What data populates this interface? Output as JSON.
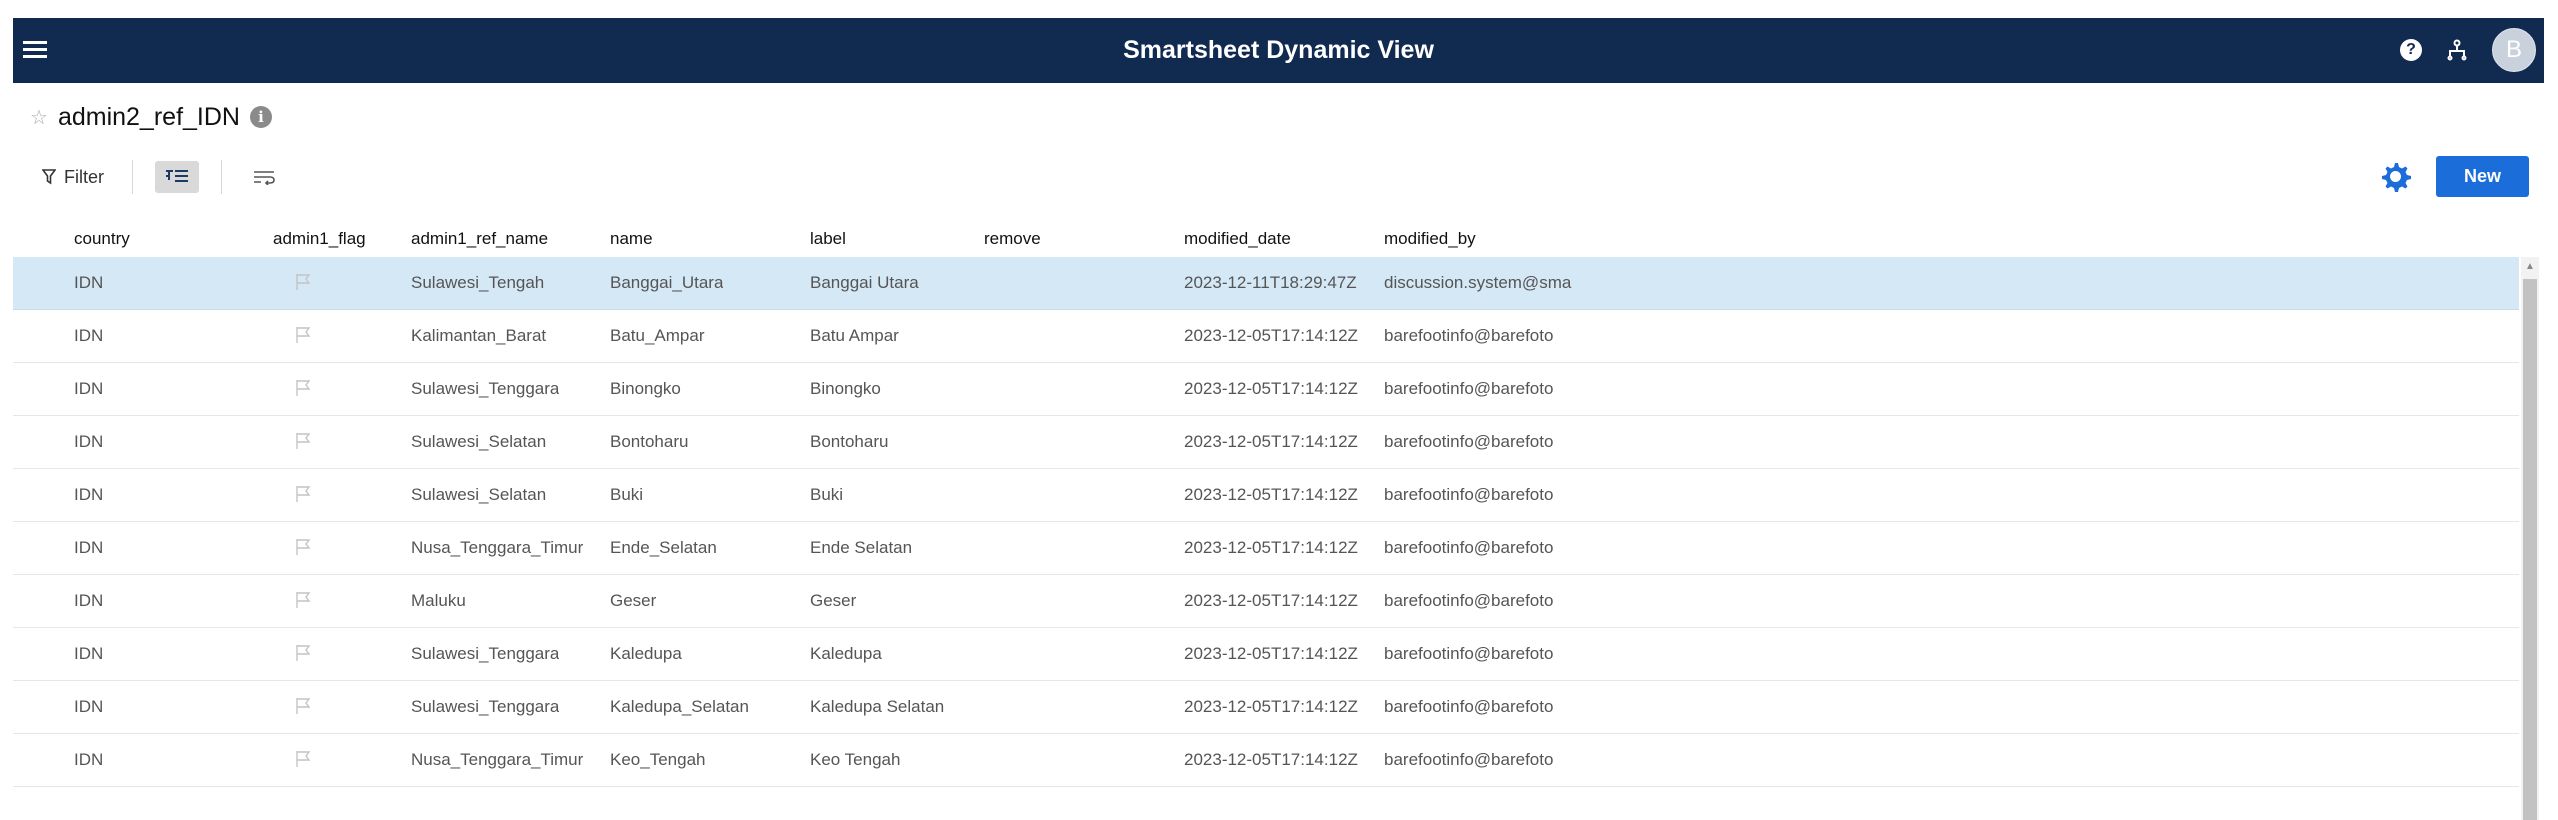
{
  "app": {
    "title": "Smartsheet Dynamic View",
    "avatar_initial": "B",
    "help_glyph": "?"
  },
  "sheet": {
    "title": "admin2_ref_IDN",
    "info_glyph": "i"
  },
  "toolbar": {
    "filter_label": "Filter",
    "new_label": "New"
  },
  "icons": [
    "menu-icon",
    "help-icon",
    "share-icon",
    "avatar",
    "star-icon",
    "info-icon",
    "funnel-icon",
    "grid-view-icon",
    "wrap-icon",
    "gear-icon",
    "flag-icon"
  ],
  "colors": {
    "header_bg": "#112a4f",
    "accent": "#1b6ed9",
    "selected_row": "#d5e8f6"
  },
  "table": {
    "columns": [
      "country",
      "admin1_flag",
      "admin1_ref_name",
      "name",
      "label",
      "remove",
      "modified_date",
      "modified_by"
    ],
    "rows": [
      {
        "country": "IDN",
        "admin1_ref_name": "Sulawesi_Tengah",
        "name": "Banggai_Utara",
        "label": "Banggai Utara",
        "remove": "",
        "modified_date": "2023-12-11T18:29:47Z",
        "modified_by": "discussion.system@sma"
      },
      {
        "country": "IDN",
        "admin1_ref_name": "Kalimantan_Barat",
        "name": "Batu_Ampar",
        "label": "Batu Ampar",
        "remove": "",
        "modified_date": "2023-12-05T17:14:12Z",
        "modified_by": "barefootinfo@barefoto"
      },
      {
        "country": "IDN",
        "admin1_ref_name": "Sulawesi_Tenggara",
        "name": "Binongko",
        "label": "Binongko",
        "remove": "",
        "modified_date": "2023-12-05T17:14:12Z",
        "modified_by": "barefootinfo@barefoto"
      },
      {
        "country": "IDN",
        "admin1_ref_name": "Sulawesi_Selatan",
        "name": "Bontoharu",
        "label": "Bontoharu",
        "remove": "",
        "modified_date": "2023-12-05T17:14:12Z",
        "modified_by": "barefootinfo@barefoto"
      },
      {
        "country": "IDN",
        "admin1_ref_name": "Sulawesi_Selatan",
        "name": "Buki",
        "label": "Buki",
        "remove": "",
        "modified_date": "2023-12-05T17:14:12Z",
        "modified_by": "barefootinfo@barefoto"
      },
      {
        "country": "IDN",
        "admin1_ref_name": "Nusa_Tenggara_Timur",
        "name": "Ende_Selatan",
        "label": "Ende Selatan",
        "remove": "",
        "modified_date": "2023-12-05T17:14:12Z",
        "modified_by": "barefootinfo@barefoto"
      },
      {
        "country": "IDN",
        "admin1_ref_name": "Maluku",
        "name": "Geser",
        "label": "Geser",
        "remove": "",
        "modified_date": "2023-12-05T17:14:12Z",
        "modified_by": "barefootinfo@barefoto"
      },
      {
        "country": "IDN",
        "admin1_ref_name": "Sulawesi_Tenggara",
        "name": "Kaledupa",
        "label": "Kaledupa",
        "remove": "",
        "modified_date": "2023-12-05T17:14:12Z",
        "modified_by": "barefootinfo@barefoto"
      },
      {
        "country": "IDN",
        "admin1_ref_name": "Sulawesi_Tenggara",
        "name": "Kaledupa_Selatan",
        "label": "Kaledupa Selatan",
        "remove": "",
        "modified_date": "2023-12-05T17:14:12Z",
        "modified_by": "barefootinfo@barefoto"
      },
      {
        "country": "IDN",
        "admin1_ref_name": "Nusa_Tenggara_Timur",
        "name": "Keo_Tengah",
        "label": "Keo Tengah",
        "remove": "",
        "modified_date": "2023-12-05T17:14:12Z",
        "modified_by": "barefootinfo@barefoto"
      }
    ]
  }
}
